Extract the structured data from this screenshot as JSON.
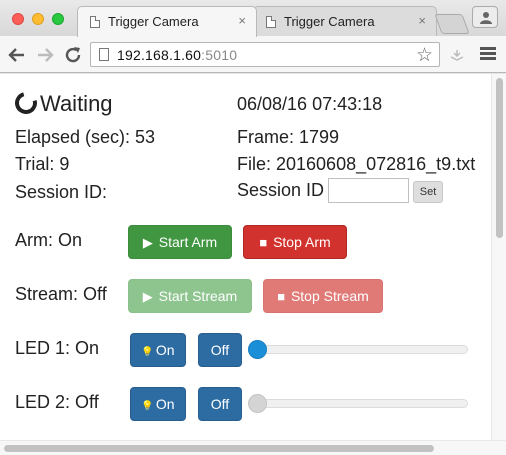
{
  "browser": {
    "tabs": [
      {
        "title": "Trigger Camera",
        "close": "×"
      },
      {
        "title": "Trigger Camera",
        "close": "×"
      }
    ],
    "url_host": "192.168.1.60",
    "url_port": ":5010",
    "bookmark_glyph": "☆"
  },
  "status": {
    "state": "Waiting",
    "datetime": "06/08/16 07:43:18",
    "elapsed": "Elapsed (sec): 53",
    "frame": "Frame: 1799",
    "trial": "Trial: 9",
    "file": "File: 20160608_072816_t9.txt",
    "session_label": "Session ID:",
    "session_input_label": "Session ID",
    "session_value": "",
    "set_button": "Set"
  },
  "arm": {
    "label": "Arm: On",
    "start": "Start Arm",
    "stop": "Stop Arm",
    "start_glyph": "▶",
    "stop_glyph": "■"
  },
  "stream": {
    "label": "Stream: Off",
    "start": "Start Stream",
    "stop": "Stop Stream",
    "start_glyph": "▶",
    "stop_glyph": "■"
  },
  "led1": {
    "label": "LED 1: On",
    "on": "On",
    "off": "Off",
    "bulb_glyph": "💡",
    "level": 0
  },
  "led2": {
    "label": "LED 2: Off",
    "on": "On",
    "off": "Off",
    "bulb_glyph": "💡",
    "level": 0
  },
  "colors": {
    "green": "#419641",
    "red": "#d2322d",
    "blue": "#2d6ca2",
    "slider_active": "#1a8fd8"
  }
}
